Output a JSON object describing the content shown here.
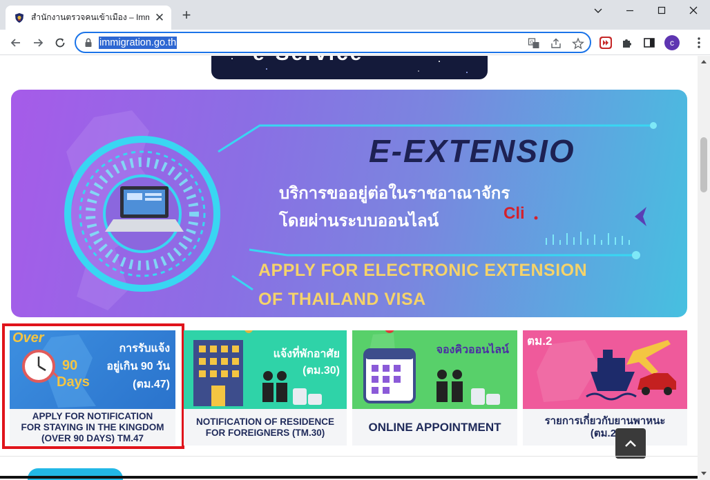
{
  "browser": {
    "tab_title": "สำนักงานตรวจคนเข้าเมือง – Immigration",
    "tab_close": "✕",
    "new_tab": "+",
    "url": "immigration.go.th",
    "avatar_letter": "c"
  },
  "page": {
    "top_banner_text": "e-Service",
    "banner": {
      "title": "E-EXTENSIO",
      "thai_line1": "บริการขออยู่ต่อในราชอาณาจักร",
      "thai_line2": "โดยผ่านระบบออนไลน์",
      "cli_text": "Cli",
      "en_line1": "APPLY FOR ELECTRONIC EXTENSION",
      "en_line2": "OF THAILAND VISA"
    },
    "cards": [
      {
        "img_over": "Over",
        "img_days_num": "90",
        "img_days": "Days",
        "img_thai1": "การรับแจ้ง",
        "img_thai2": "อยู่เกิน 90 วัน",
        "img_thai3": "(ตม.47)",
        "caption1": "APPLY FOR NOTIFICATION",
        "caption2": "FOR STAYING IN THE KINGDOM",
        "caption3": "(OVER 90 DAYS) TM.47"
      },
      {
        "img_thai1": "แจ้งที่พักอาศัย",
        "img_thai2": "(ตม.30)",
        "caption1": "NOTIFICATION OF RESIDENCE",
        "caption2": "FOR FOREIGNERS (TM.30)"
      },
      {
        "img_thai1": "จองคิวออนไลน์",
        "caption1": "ONLINE APPOINTMENT"
      },
      {
        "img_tag": "ตม.2",
        "caption1": "รายการเกี่ยวกับยานพาหนะ",
        "caption2": "(ตม.2)"
      }
    ]
  },
  "colors": {
    "highlight": "#e0141b",
    "url_selection": "#2e67d2",
    "caption_text": "#1f2a5a"
  }
}
